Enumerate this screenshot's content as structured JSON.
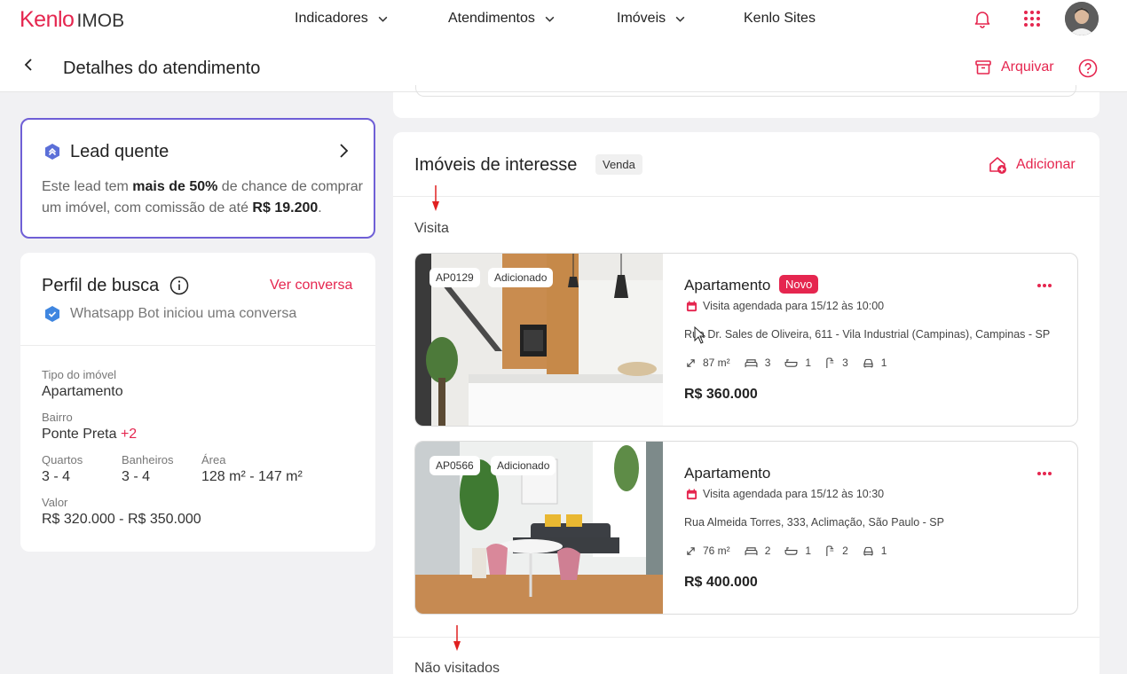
{
  "brand": {
    "name": "Kenlo",
    "product": "IMOB",
    "accent": "#e5264f"
  },
  "nav": {
    "items": [
      {
        "label": "Indicadores",
        "has_dropdown": true
      },
      {
        "label": "Atendimentos",
        "has_dropdown": true
      },
      {
        "label": "Imóveis",
        "has_dropdown": true
      },
      {
        "label": "Kenlo Sites",
        "has_dropdown": false
      }
    ],
    "icons": [
      "bell-icon",
      "apps-grid-icon",
      "user-avatar"
    ]
  },
  "header": {
    "title": "Detalhes do atendimento",
    "archive_label": "Arquivar"
  },
  "lead": {
    "title": "Lead quente",
    "text_pre": "Este lead tem ",
    "text_bold1": "mais de 50%",
    "text_mid": " de chance de comprar um imóvel, com comissão de até ",
    "text_bold2": "R$ 19.200",
    "text_post": "."
  },
  "perfil": {
    "title": "Perfil de busca",
    "ver_conversa": "Ver conversa",
    "bot_text": "Whatsapp Bot iniciou uma conversa",
    "tipo_label": "Tipo do imóvel",
    "tipo_value": "Apartamento",
    "bairro_label": "Bairro",
    "bairro_value": "Ponte Preta",
    "bairro_extra": "+2",
    "quartos_label": "Quartos",
    "quartos_value": "3 - 4",
    "banheiros_label": "Banheiros",
    "banheiros_value": "3 - 4",
    "area_label": "Área",
    "area_value": "128 m² - 147 m²",
    "valor_label": "Valor",
    "valor_value": "R$ 320.000 - R$ 350.000"
  },
  "interesse": {
    "title": "Imóveis de interesse",
    "badge": "Venda",
    "add_label": "Adicionar",
    "section_visita": "Visita",
    "section_nao_visitados": "Não visitados",
    "properties": [
      {
        "code": "AP0129",
        "status_tag": "Adicionado",
        "type": "Apartamento",
        "new_badge": "Novo",
        "visit": "Visita agendada para 15/12 às 10:00",
        "address": "Rua Dr. Sales de Oliveira, 611 - Vila Industrial (Campinas), Campinas - SP",
        "area": "87 m²",
        "bedrooms": "3",
        "bathrooms": "1",
        "suites": "3",
        "parking": "1",
        "price": "R$ 360.000"
      },
      {
        "code": "AP0566",
        "status_tag": "Adicionado",
        "type": "Apartamento",
        "new_badge": "",
        "visit": "Visita agendada para 15/12 às 10:30",
        "address": "Rua Almeida Torres, 333, Aclimação, São Paulo - SP",
        "area": "76 m²",
        "bedrooms": "2",
        "bathrooms": "1",
        "suites": "2",
        "parking": "1",
        "price": "R$ 400.000"
      }
    ]
  }
}
